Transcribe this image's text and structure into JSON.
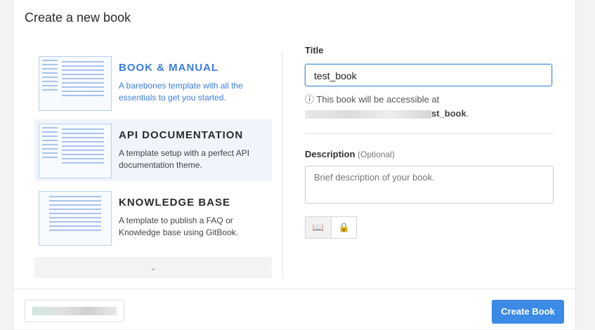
{
  "dialog": {
    "title": "Create a new book"
  },
  "templates": [
    {
      "name": "BOOK & MANUAL",
      "description": "A barebones template with all the essentials to get you started.",
      "active": true
    },
    {
      "name": "API DOCUMENTATION",
      "description": "A template setup with a perfect API documentation theme.",
      "active": false,
      "selected": true
    },
    {
      "name": "KNOWLEDGE BASE",
      "description": "A template to publish a FAQ or Knowledge base using GitBook.",
      "active": false
    }
  ],
  "more_icon": "chevron-down-icon",
  "form": {
    "title_label": "Title",
    "title_value": "test_book",
    "hint_text": "This book will be accessible at",
    "hint_url_suffix": "st_book",
    "description_label": "Description",
    "description_optional": "(Optional)",
    "description_placeholder": "Brief description of your book.",
    "visibility_icons": [
      "book-icon",
      "lock-icon"
    ]
  },
  "footer": {
    "create_label": "Create Book"
  },
  "colors": {
    "accent": "#3b8be6",
    "active_text": "#3b7ddd"
  }
}
